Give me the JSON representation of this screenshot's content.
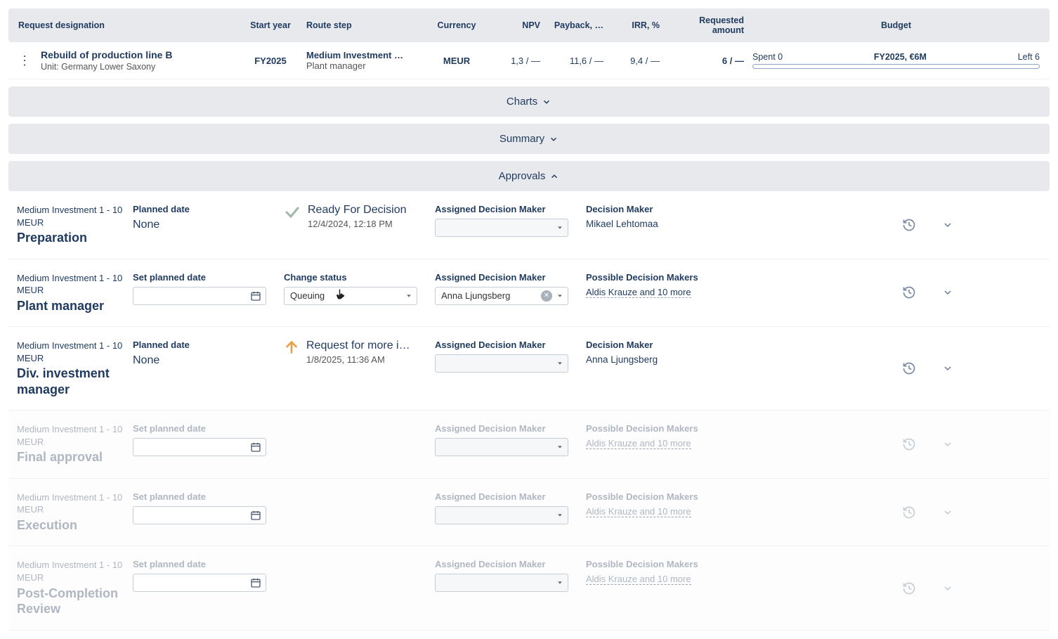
{
  "header": {
    "request_designation": "Request designation",
    "start_year": "Start year",
    "route_step": "Route step",
    "currency": "Currency",
    "npv": "NPV",
    "payback": "Payback, …",
    "irr": "IRR, %",
    "requested_amount": "Requested amount",
    "budget": "Budget"
  },
  "row": {
    "title": "Rebuild of production line B",
    "unit": "Unit: Germany Lower Saxony",
    "start_year": "FY2025",
    "route_step_1": "Medium Investment …",
    "route_step_2": "Plant manager",
    "currency": "MEUR",
    "npv": "1,3 / —",
    "payback": "11,6 / —",
    "irr": "9,4 / —",
    "requested": "6 / —",
    "spent": "Spent 0",
    "budget_label": "FY2025, €6M",
    "left": "Left 6"
  },
  "sections": {
    "charts": "Charts",
    "summary": "Summary",
    "approvals": "Approvals"
  },
  "labels": {
    "planned_date": "Planned date",
    "set_planned_date": "Set planned date",
    "change_status": "Change status",
    "assigned_dm": "Assigned Decision Maker",
    "decision_maker": "Decision Maker",
    "possible_dm": "Possible Decision Makers",
    "none": "None"
  },
  "approvals": [
    {
      "super": "Medium Investment 1 - 10 MEUR",
      "stage": "Preparation",
      "mode": "readonly_status",
      "planned": "None",
      "status": "Ready For Decision",
      "status_time": "12/4/2024, 12:18 PM",
      "status_icon": "check",
      "dm_name": "Mikael Lehtomaa",
      "disabled": false
    },
    {
      "super": "Medium Investment 1 - 10 MEUR",
      "stage": "Plant manager",
      "mode": "editable",
      "status_select": "Queuing",
      "assigned_value": "Anna Ljungsberg",
      "possible_link": "Aldis Krauze and 10 more",
      "disabled": false
    },
    {
      "super": "Medium Investment 1 - 10 MEUR",
      "stage": "Div. investment manager",
      "mode": "readonly_status",
      "planned": "None",
      "status": "Request for more i…",
      "status_time": "1/8/2025, 11:36 AM",
      "status_icon": "arrow-up",
      "dm_name": "Anna Ljungsberg",
      "disabled": false
    },
    {
      "super": "Medium Investment 1 - 10 MEUR",
      "stage": "Final approval",
      "mode": "disabled_edit",
      "possible_link": "Aldis Krauze and 10 more",
      "disabled": true
    },
    {
      "super": "Medium Investment 1 - 10 MEUR",
      "stage": "Execution",
      "mode": "disabled_edit",
      "possible_link": "Aldis Krauze and 10 more",
      "disabled": true
    },
    {
      "super": "Medium Investment 1 - 10 MEUR",
      "stage": "Post-Completion Review",
      "mode": "disabled_edit",
      "possible_link": "Aldis Krauze and 10 more",
      "disabled": true
    }
  ]
}
